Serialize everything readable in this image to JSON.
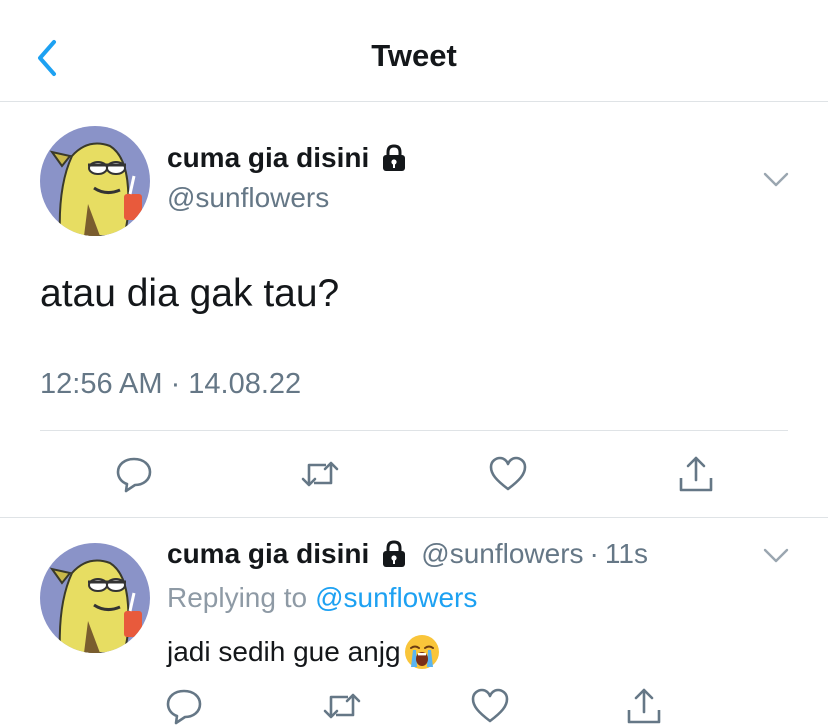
{
  "header": {
    "title": "Tweet",
    "back_icon": "chevron-left-icon",
    "accent": "#1da1f2"
  },
  "tweet": {
    "display_name": "cuma gia disini",
    "handle": "@sunflowers",
    "text": "atau dia gak tau?",
    "timestamp": "12:56 AM · 14.08.22",
    "locked": true,
    "actions": [
      "reply-icon",
      "retweet-icon",
      "like-icon",
      "share-icon"
    ]
  },
  "reply": {
    "display_name": "cuma gia disini",
    "handle": "@sunflowers",
    "separator": "·",
    "time_ago": "11s",
    "replying_prefix": "Replying to",
    "replying_to": "@sunflowers",
    "text": "jadi sedih gue anjg",
    "emoji": "loudly-crying-face",
    "locked": true,
    "actions": [
      "reply-icon",
      "retweet-icon",
      "like-icon",
      "share-icon"
    ]
  },
  "colors": {
    "text": "#14171a",
    "secondary": "#657786",
    "divider": "#dfe3e6",
    "link": "#1da1f2"
  }
}
